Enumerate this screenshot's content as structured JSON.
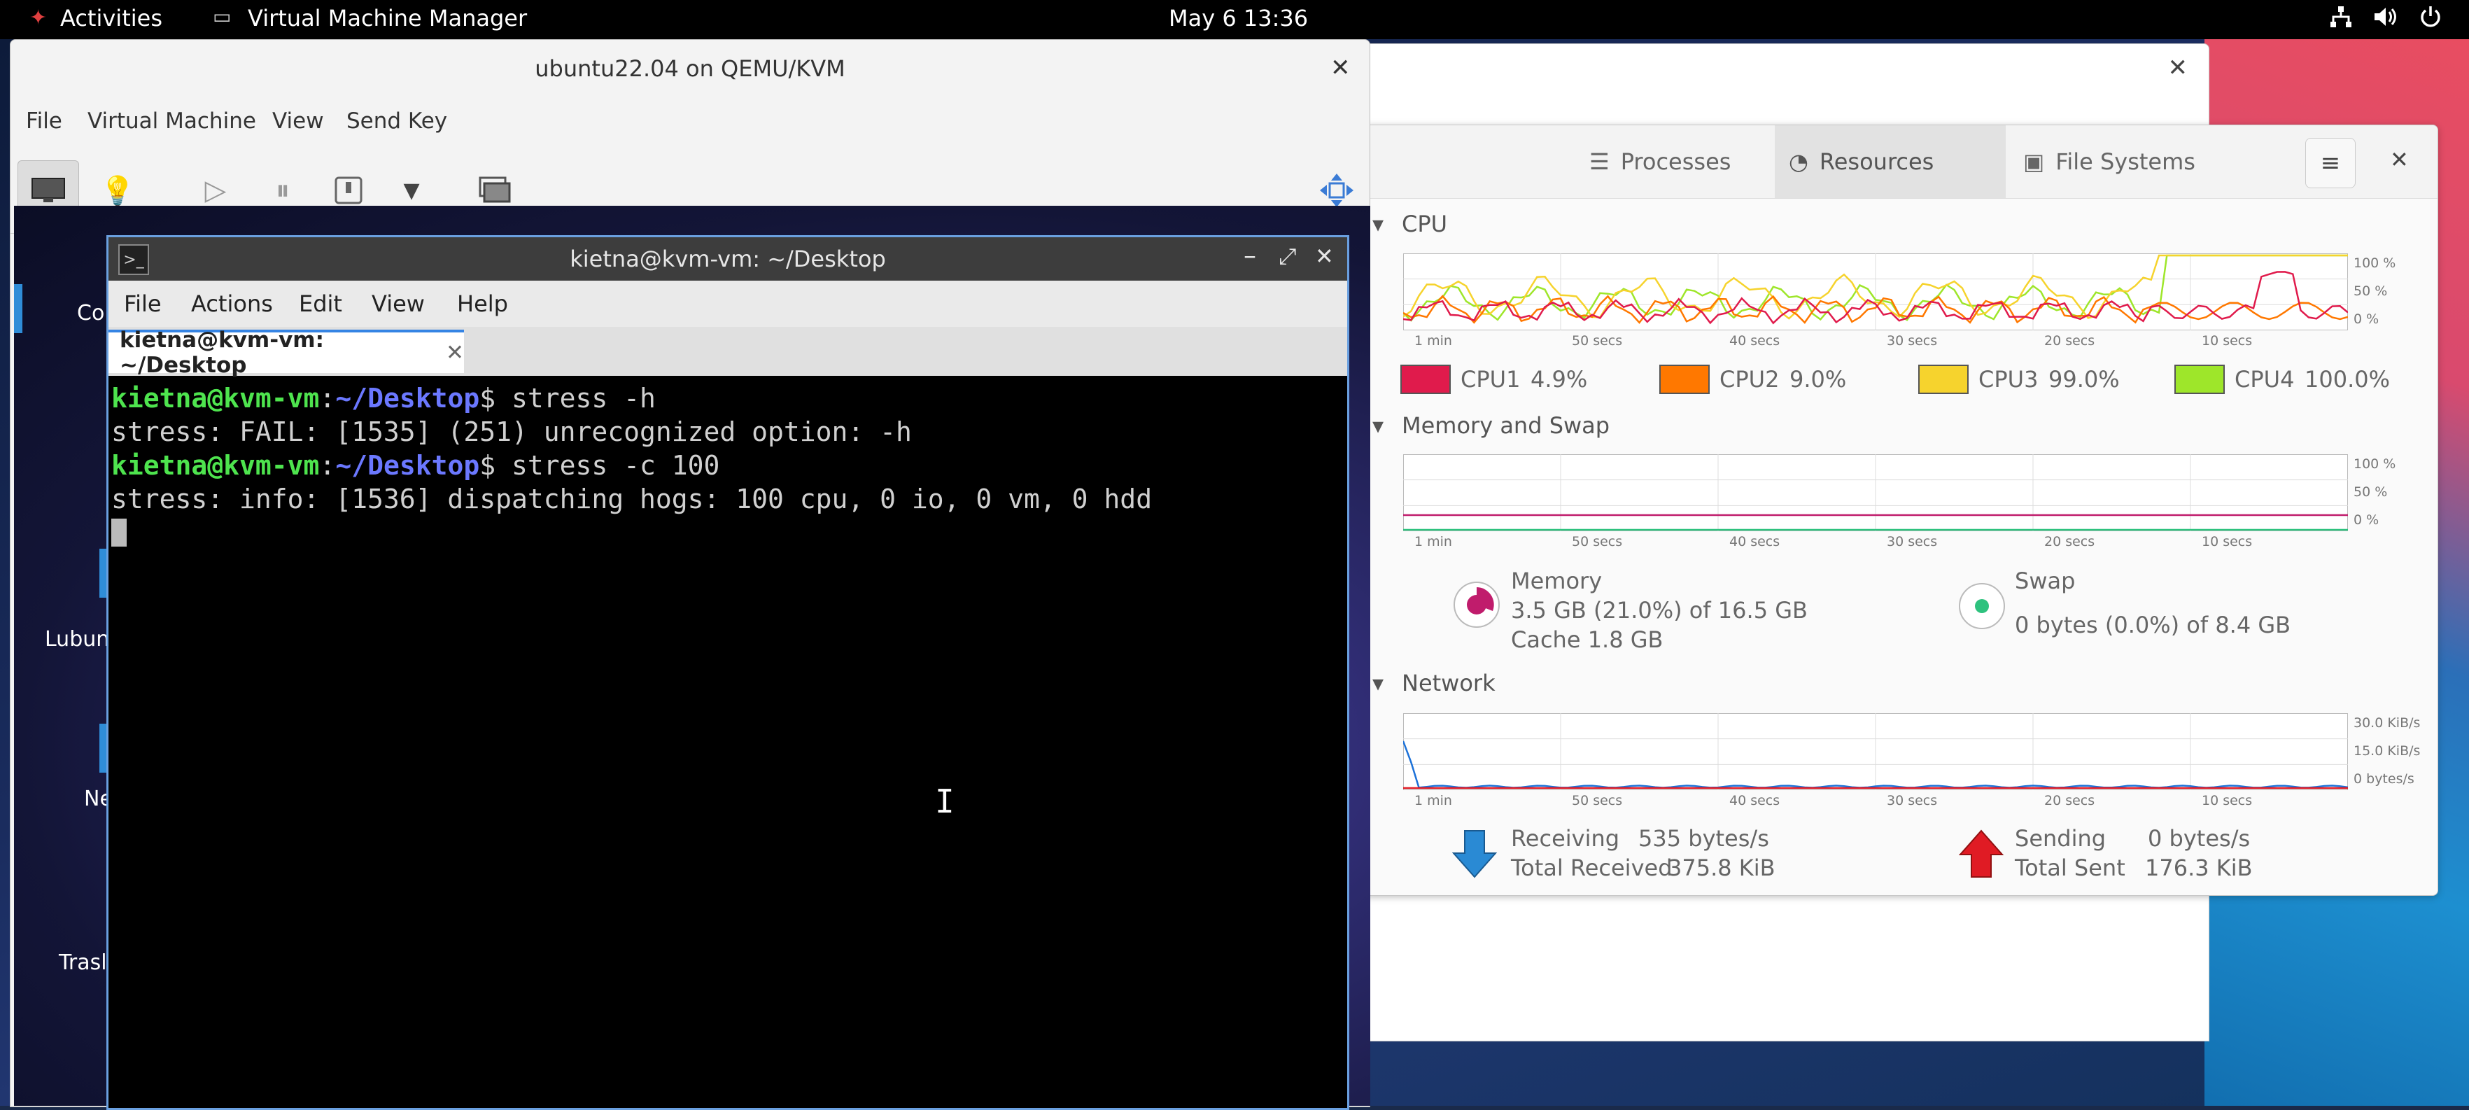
{
  "topbar": {
    "activities": "Activities",
    "app_name": "Virtual Machine Manager",
    "datetime": "May 6  13:36"
  },
  "vm_window": {
    "title": "ubuntu22.04 on QEMU/KVM",
    "menu": [
      "File",
      "Virtual Machine",
      "View",
      "Send Key"
    ]
  },
  "desktop_icons": [
    "Co",
    "Lubun",
    "Ne",
    "Trasl"
  ],
  "terminal": {
    "title": "kietna@kvm-vm: ~/Desktop",
    "menu": [
      "File",
      "Actions",
      "Edit",
      "View",
      "Help"
    ],
    "tab_label": "kietna@kvm-vm: ~/Desktop",
    "prompt_user": "kietna@kvm-vm",
    "prompt_sep": ":",
    "prompt_path": "~/Desktop",
    "prompt_end": "$",
    "lines": [
      {
        "type": "cmd",
        "text": " stress -h"
      },
      {
        "type": "out",
        "text": "stress: FAIL: [1535] (251) unrecognized option: -h"
      },
      {
        "type": "cmd",
        "text": " stress -c 100"
      },
      {
        "type": "out",
        "text": "stress: info: [1536] dispatching hogs: 100 cpu, 0 io, 0 vm, 0 hdd"
      }
    ]
  },
  "system_monitor": {
    "tabs": [
      "Processes",
      "Resources",
      "File Systems"
    ],
    "active_tab": "Resources",
    "cpu": {
      "title": "CPU",
      "legend": [
        {
          "name": "CPU1",
          "value": "4.9%",
          "color": "#e01b4c"
        },
        {
          "name": "CPU2",
          "value": "9.0%",
          "color": "#ff7800"
        },
        {
          "name": "CPU3",
          "value": "99.0%",
          "color": "#f6d32d"
        },
        {
          "name": "CPU4",
          "value": "100.0%",
          "color": "#9ee62a"
        }
      ],
      "y_ticks": [
        "100 %",
        "50 %",
        "0 %"
      ],
      "x_ticks": [
        "1 min",
        "50 secs",
        "40 secs",
        "30 secs",
        "20 secs",
        "10 secs"
      ]
    },
    "memory": {
      "title": "Memory and Swap",
      "y_ticks": [
        "100 %",
        "50 %",
        "0 %"
      ],
      "x_ticks": [
        "1 min",
        "50 secs",
        "40 secs",
        "30 secs",
        "20 secs",
        "10 secs"
      ],
      "memory_label": "Memory",
      "memory_usage": "3.5 GB (21.0%) of 16.5 GB",
      "cache": "Cache 1.8 GB",
      "swap_label": "Swap",
      "swap_usage": "0 bytes (0.0%) of 8.4 GB",
      "memory_color": "#c01c6c",
      "swap_color": "#2ec27e"
    },
    "network": {
      "title": "Network",
      "y_ticks": [
        "30.0 KiB/s",
        "15.0 KiB/s",
        "0 bytes/s"
      ],
      "x_ticks": [
        "1 min",
        "50 secs",
        "40 secs",
        "30 secs",
        "20 secs",
        "10 secs"
      ],
      "receiving_label": "Receiving",
      "receiving_value": "535 bytes/s",
      "total_received_label": "Total Received",
      "total_received_value": "375.8 KiB",
      "sending_label": "Sending",
      "sending_value": "0 bytes/s",
      "total_sent_label": "Total Sent",
      "total_sent_value": "176.3 KiB"
    }
  }
}
